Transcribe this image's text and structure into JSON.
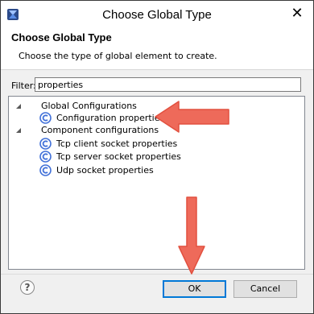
{
  "window": {
    "title": "Choose Global Type",
    "close_glyph": "✕"
  },
  "banner": {
    "title": "Choose Global Type",
    "description": "Choose the type of global element to create."
  },
  "filter": {
    "label": "Filter:",
    "value": "properties"
  },
  "tree": [
    {
      "label": "Global Configurations",
      "kind": "group",
      "expanded": true
    },
    {
      "label": "Configuration properties",
      "kind": "item",
      "icon": "global-element-icon"
    },
    {
      "label": "Component configurations",
      "kind": "group",
      "expanded": true
    },
    {
      "label": "Tcp client socket properties",
      "kind": "item",
      "icon": "global-element-icon"
    },
    {
      "label": "Tcp server socket properties",
      "kind": "item",
      "icon": "global-element-icon"
    },
    {
      "label": "Udp socket properties",
      "kind": "item",
      "icon": "global-element-icon"
    }
  ],
  "buttons": {
    "help": "?",
    "ok": "OK",
    "cancel": "Cancel"
  },
  "colors": {
    "annotation_arrow": "#ee6a5a",
    "icon_blue": "#3f6fd8",
    "focus_border": "#0078d7"
  }
}
